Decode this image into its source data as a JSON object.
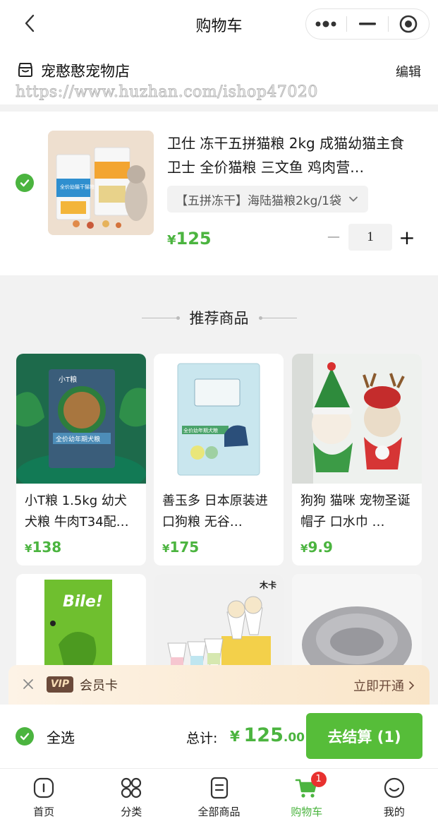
{
  "navbar": {
    "title": "购物车"
  },
  "shop": {
    "name": "宠憨憨宠物店",
    "edit_label": "编辑",
    "watermark": "https://www.huzhan.com/ishop47020"
  },
  "cart_item": {
    "title": "卫仕 冻干五拼猫粮 2kg 成猫幼猫主食 卫士 全价猫粮 三文鱼 鸡肉营…",
    "spec": "【五拼冻干】海陆猫粮2kg/1袋",
    "price_currency": "¥",
    "price": "125",
    "quantity": "1",
    "minus": "−",
    "plus": "+",
    "pack_text": "全价幼猫干猫粮"
  },
  "recommend": {
    "title": "推荐商品",
    "items": [
      {
        "title": "小T粮 1.5kg 幼犬犬粮 牛肉T34配…",
        "currency": "¥",
        "price": "138",
        "pack_brand": "小T粮",
        "pack_text": "全价幼年期犬粮"
      },
      {
        "title": "善玉多 日本原装进口狗粮 无谷…",
        "currency": "¥",
        "price": "175",
        "pack_text": "全价幼年期犬粮"
      },
      {
        "title": "狗狗 猫咪 宠物圣诞帽子 口水巾 …",
        "currency": "¥",
        "price": "9.9"
      },
      {
        "title": "",
        "currency": "",
        "price": "",
        "pack_brand": "Bile!"
      },
      {
        "title": "",
        "currency": "",
        "price": "",
        "pack_brand": "木卡"
      },
      {
        "title": "",
        "currency": "",
        "price": ""
      }
    ]
  },
  "vip": {
    "badge": "VIP",
    "label": "会员卡",
    "action": "立即开通"
  },
  "checkout": {
    "select_all": "全选",
    "total_label": "总计:",
    "currency": "¥",
    "total_int": "125",
    "total_dec": ".00",
    "button": "去结算 (1)"
  },
  "tabbar": {
    "items": [
      {
        "label": "首页",
        "icon": "home-icon"
      },
      {
        "label": "分类",
        "icon": "category-icon"
      },
      {
        "label": "全部商品",
        "icon": "all-products-icon"
      },
      {
        "label": "购物车",
        "icon": "cart-icon",
        "badge": "1"
      },
      {
        "label": "我的",
        "icon": "profile-icon"
      }
    ]
  },
  "colors": {
    "accent": "#4bb43f",
    "badge": "#e8312f",
    "vip_brown": "#6b4a3a"
  }
}
